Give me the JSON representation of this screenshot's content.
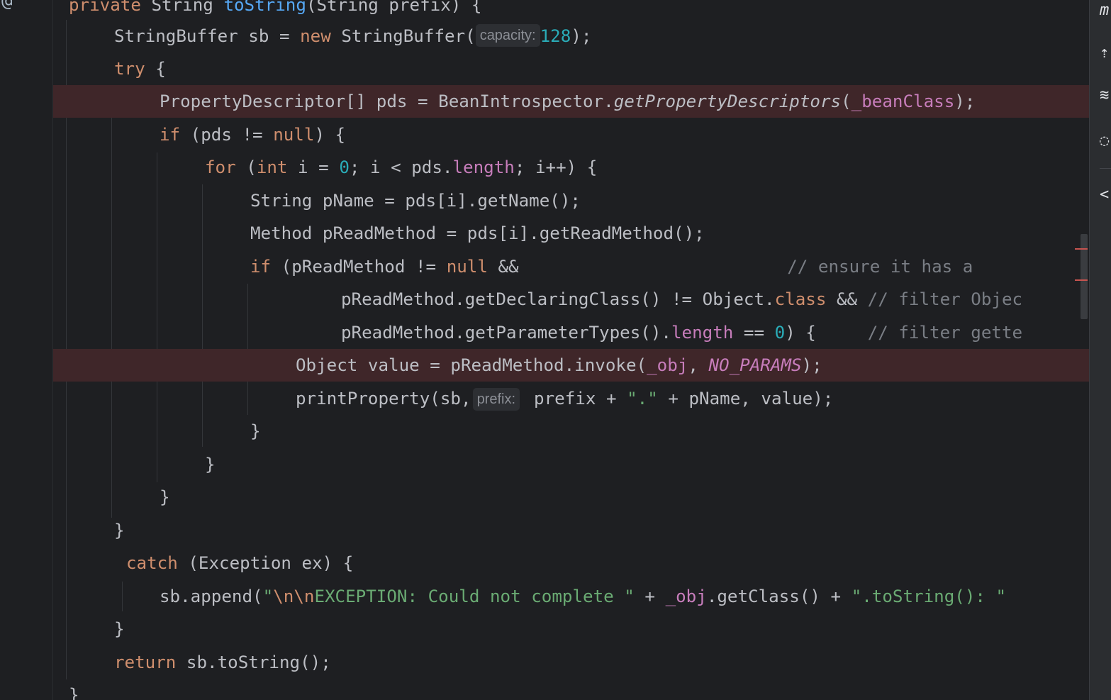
{
  "editor": {
    "gutter_symbol": "@",
    "hints": {
      "capacity": "capacity:",
      "prefix": "prefix:"
    },
    "lines": [
      "private String toString(String prefix) {",
      "StringBuffer sb = new StringBuffer( 128);",
      "try {",
      "PropertyDescriptor[] pds = BeanIntrospector.getPropertyDescriptors(_beanClass);",
      "if (pds != null) {",
      "for (int i = 0; i < pds.length; i++) {",
      "String pName = pds[i].getName();",
      "Method pReadMethod = pds[i].getReadMethod();",
      "if (pReadMethod != null &&                          // ensure it has a",
      "pReadMethod.getDeclaringClass() != Object.class && // filter Objec",
      "pReadMethod.getParameterTypes().length == 0) {     // filter gette",
      "Object value = pReadMethod.invoke(_obj, NO_PARAMS);",
      "printProperty(sb, prefix + \".\" + pName, value);",
      "}",
      "}",
      "}",
      "}",
      "catch (Exception ex) {",
      "sb.append(\"\\n\\nEXCEPTION: Could not complete \" + _obj.getClass() + \".toString(): \"",
      "}",
      "return sb.toString();",
      "}"
    ]
  },
  "right_panel": {
    "icons": [
      "m-icon",
      "up-arrow-icon",
      "structure-icon",
      "lasso-icon",
      "share-icon"
    ]
  },
  "colors": {
    "background": "#1e1f22",
    "breakpoint_line": "#3f2629",
    "keyword": "#cf8e6d",
    "number": "#2aacb8",
    "string": "#6aab73",
    "comment": "#7a7e85",
    "field": "#c77dbb",
    "function": "#56a8f5"
  }
}
